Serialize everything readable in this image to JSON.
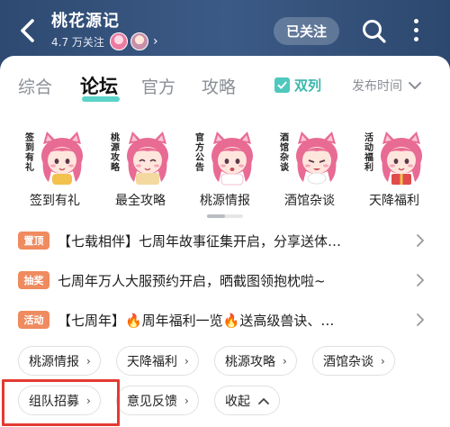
{
  "header": {
    "title": "桃花源记",
    "followers": "4.7 万关注",
    "follow_button": "已关注",
    "back_icon": "chevron-left-icon",
    "search_icon": "search-icon",
    "more_icon": "more-vertical-icon"
  },
  "tabs": [
    {
      "label": "综合",
      "active": false
    },
    {
      "label": "论坛",
      "active": true
    },
    {
      "label": "官方",
      "active": false
    },
    {
      "label": "攻略",
      "active": false
    }
  ],
  "view_toggle": {
    "label": "双列",
    "checked": true
  },
  "sort": {
    "label": "发布时间"
  },
  "categories": [
    {
      "label": "签到有礼",
      "sign": [
        "签",
        "到",
        "有",
        "礼"
      ]
    },
    {
      "label": "最全攻略",
      "sign": [
        "桃",
        "源",
        "攻",
        "略"
      ]
    },
    {
      "label": "桃源情报",
      "sign": [
        "官",
        "方",
        "公",
        "告"
      ]
    },
    {
      "label": "酒馆杂谈",
      "sign": [
        "酒",
        "馆",
        "杂",
        "谈"
      ]
    },
    {
      "label": "天降福利",
      "sign": [
        "活",
        "动",
        "福",
        "利"
      ]
    }
  ],
  "notices": [
    {
      "badge": "置顶",
      "text": "【七载相伴】七周年故事征集开启，分享送体…"
    },
    {
      "badge": "抽奖",
      "text": "七周年万人大服预约开启，晒截图领抱枕啦~"
    },
    {
      "badge": "活动",
      "text": "【七周年】🔥周年福利一览🔥送高级兽诀、…"
    }
  ],
  "tags": [
    {
      "label": "桃源情报"
    },
    {
      "label": "天降福利"
    },
    {
      "label": "桃源攻略"
    },
    {
      "label": "酒馆杂谈"
    },
    {
      "label": "组队招募"
    },
    {
      "label": "意见反馈"
    }
  ],
  "collapse": {
    "label": "收起"
  },
  "colors": {
    "header_bg": "#2f4a70",
    "accent_teal": "#4fc8be",
    "badge_orange": "#ef8b5f",
    "highlight_red": "#e33a33"
  }
}
